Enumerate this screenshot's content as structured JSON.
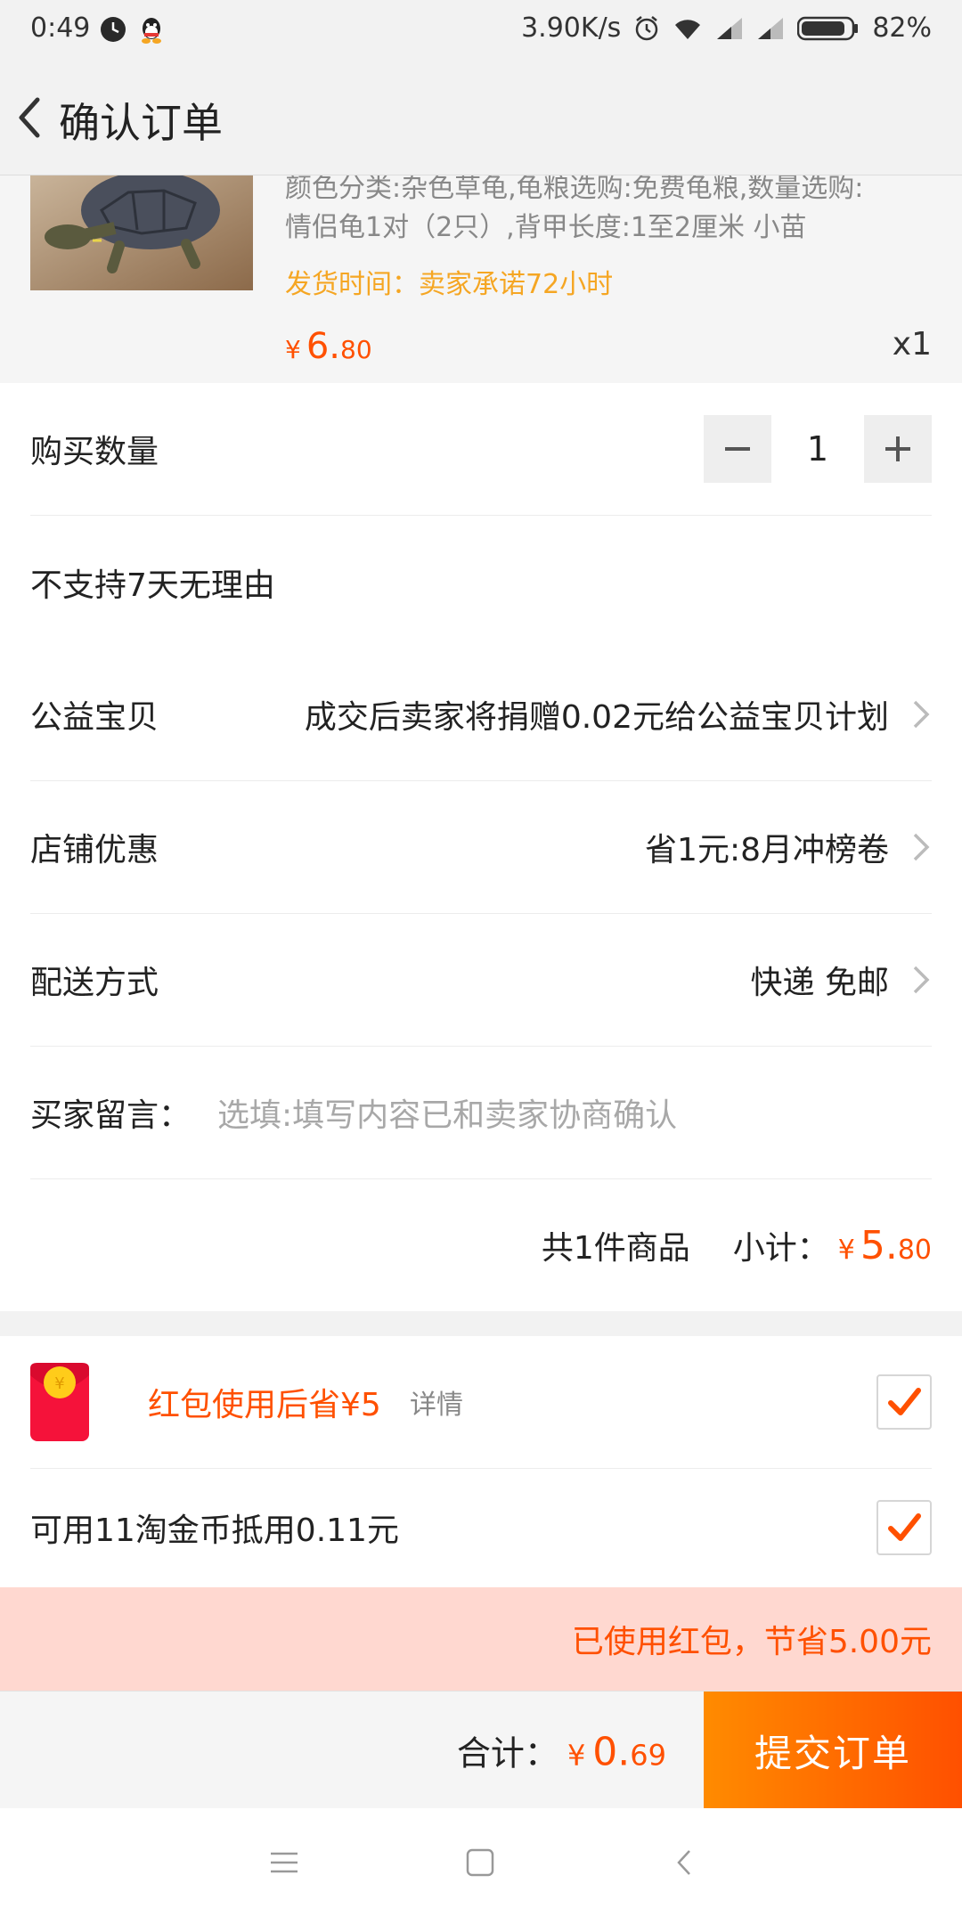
{
  "status_bar": {
    "time": "0:49",
    "net_speed": "3.90K/s",
    "battery": "82%",
    "icons": [
      "clock-app-icon",
      "qq-icon",
      "alarm-icon",
      "wifi-icon",
      "signal-icon",
      "signal-icon-2",
      "battery-icon"
    ]
  },
  "header": {
    "title": "确认订单",
    "back_icon": "chevron-left-icon"
  },
  "product": {
    "spec_line1": "颜色分类:杂色草龟,龟粮选购:免费龟粮,数量选购:",
    "spec_line2": "情侣龟1对（2只）,背甲长度:1至2厘米 小苗",
    "shipping": "发货时间：卖家承诺72小时",
    "price_symbol": "¥",
    "price_int": "6.",
    "price_dec": "80",
    "quantity": "x1"
  },
  "order": {
    "quantity_label": "购买数量",
    "quantity_value": "1",
    "no_return_label": "不支持7天无理由",
    "charity_label": "公益宝贝",
    "charity_value": "成交后卖家将捐赠0.02元给公益宝贝计划",
    "coupon_label": "店铺优惠",
    "coupon_value": "省1元:8月冲榜卷",
    "delivery_label": "配送方式",
    "delivery_value": "快递 免邮",
    "message_label": "买家留言：",
    "message_placeholder": "选填:填写内容已和卖家协商确认",
    "count_text": "共1件商品",
    "subtotal_label": "小计：",
    "subtotal_symbol": "¥",
    "subtotal_int": "5.",
    "subtotal_dec": "80"
  },
  "discounts": {
    "redpacket_text": "红包使用后省¥5",
    "redpacket_detail": "详情",
    "redpacket_checked": true,
    "coins_text": "可用11淘金币抵用0.11元",
    "coins_checked": true,
    "notice": "已使用红包，节省5.00元"
  },
  "footer": {
    "total_label": "合计：",
    "total_symbol": "¥",
    "total_int": "0.",
    "total_dec": "69",
    "submit_label": "提交订单"
  },
  "colors": {
    "accent": "#ff5000",
    "shipping": "#f5a623",
    "notice_bg": "#ffd8d0"
  },
  "system_nav": [
    "menu-icon",
    "home-icon",
    "back-icon"
  ]
}
